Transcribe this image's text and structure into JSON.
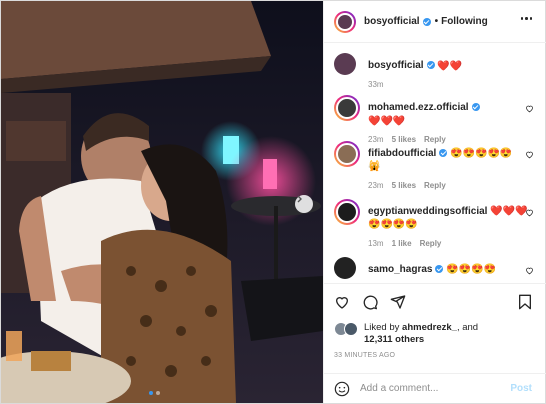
{
  "header": {
    "username": "bosyofficial",
    "follow_separator": "•",
    "follow_label": "Following"
  },
  "caption": {
    "username": "bosyofficial",
    "text": "❤️❤️",
    "time": "33m"
  },
  "comments": [
    {
      "username": "mohamed.ezz.official",
      "text": "❤️❤️❤️",
      "time": "23m",
      "likes": "5 likes",
      "reply": "Reply",
      "avatar_color": "#3a3a3a"
    },
    {
      "username": "fifiabdoufficial",
      "text": "😍😍😍😍😍🙀",
      "time": "23m",
      "likes": "5 likes",
      "reply": "Reply",
      "avatar_color": "#8a6d55"
    },
    {
      "username": "egyptianweddingsofficial",
      "text": "❤️❤️❤️😍😍😍😍",
      "time": "13m",
      "likes": "1 like",
      "reply": "Reply",
      "avatar_color": "#1c1c1c"
    },
    {
      "username": "samo_hagras",
      "text": "😍😍😍😍",
      "time": "",
      "likes": "",
      "reply": "",
      "avatar_color": "#222222"
    }
  ],
  "likes": {
    "prefix": "Liked by",
    "user": "ahmedrezk_",
    "and": "and",
    "others": "12,311 others"
  },
  "timestamp": "33 MINUTES AGO",
  "add_comment": {
    "placeholder": "Add a comment...",
    "post_label": "Post"
  },
  "colors": {
    "accent": "#3897f0",
    "post_disabled": "#b2dffc",
    "heart": "#ed1c24"
  }
}
